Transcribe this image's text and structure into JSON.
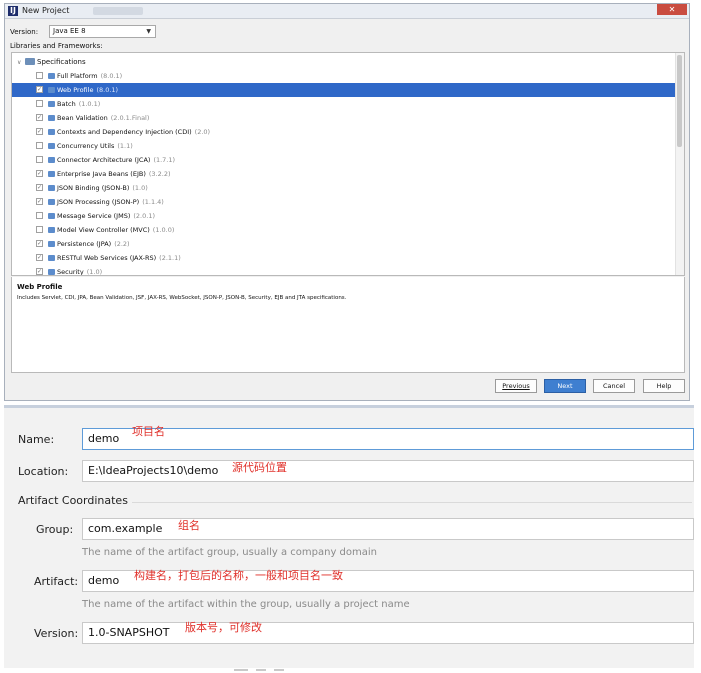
{
  "dialog": {
    "title": "New Project",
    "version_label": "Version:",
    "version_value": "Java EE 8",
    "libraries_label": "Libraries and Frameworks:",
    "tree_root": "Specifications",
    "items": [
      {
        "label": "Full Platform",
        "version": "(8.0.1)",
        "checked": false,
        "selected": false
      },
      {
        "label": "Web Profile",
        "version": "(8.0.1)",
        "checked": true,
        "selected": true
      },
      {
        "label": "Batch",
        "version": "(1.0.1)",
        "checked": false,
        "selected": false
      },
      {
        "label": "Bean Validation",
        "version": "(2.0.1.Final)",
        "checked": true,
        "selected": false
      },
      {
        "label": "Contexts and Dependency Injection (CDI)",
        "version": "(2.0)",
        "checked": true,
        "selected": false
      },
      {
        "label": "Concurrency Utils",
        "version": "(1.1)",
        "checked": false,
        "selected": false
      },
      {
        "label": "Connector Architecture (JCA)",
        "version": "(1.7.1)",
        "checked": false,
        "selected": false
      },
      {
        "label": "Enterprise Java Beans (EJB)",
        "version": "(3.2.2)",
        "checked": true,
        "selected": false
      },
      {
        "label": "JSON Binding (JSON-B)",
        "version": "(1.0)",
        "checked": true,
        "selected": false
      },
      {
        "label": "JSON Processing (JSON-P)",
        "version": "(1.1.4)",
        "checked": true,
        "selected": false
      },
      {
        "label": "Message Service (JMS)",
        "version": "(2.0.1)",
        "checked": false,
        "selected": false
      },
      {
        "label": "Model View Controller (MVC)",
        "version": "(1.0.0)",
        "checked": false,
        "selected": false
      },
      {
        "label": "Persistence (JPA)",
        "version": "(2.2)",
        "checked": true,
        "selected": false
      },
      {
        "label": "RESTful Web Services (JAX-RS)",
        "version": "(2.1.1)",
        "checked": true,
        "selected": false
      },
      {
        "label": "Security",
        "version": "(1.0)",
        "checked": true,
        "selected": false
      }
    ],
    "description_title": "Web Profile",
    "description_body": "Includes Servlet, CDI, JPA, Bean Validation, JSF, JAX-RS, WebSocket, JSON-P, JSON-B, Security, EJB and JTA specifications.",
    "buttons": {
      "previous": "Previous",
      "next": "Next",
      "cancel": "Cancel",
      "help": "Help"
    },
    "accent_color": "#2f68c8"
  },
  "form": {
    "name_label": "Name:",
    "name_value": "demo",
    "name_note": "项目名",
    "location_label": "Location:",
    "location_value": "E:\\IdeaProjects10\\demo",
    "location_note": "源代码位置",
    "section_title": "Artifact Coordinates",
    "group_label": "Group:",
    "group_value": "com.example",
    "group_note": "组名",
    "group_hint": "The name of the artifact group, usually a company domain",
    "artifact_label": "Artifact:",
    "artifact_value": "demo",
    "artifact_note": "构建名，打包后的名称，一般和项目名一致",
    "artifact_hint": "The name of the artifact within the group, usually a project name",
    "version_label": "Version:",
    "version_value": "1.0-SNAPSHOT",
    "version_note": "版本号，可修改",
    "note_color": "#e0302a"
  }
}
